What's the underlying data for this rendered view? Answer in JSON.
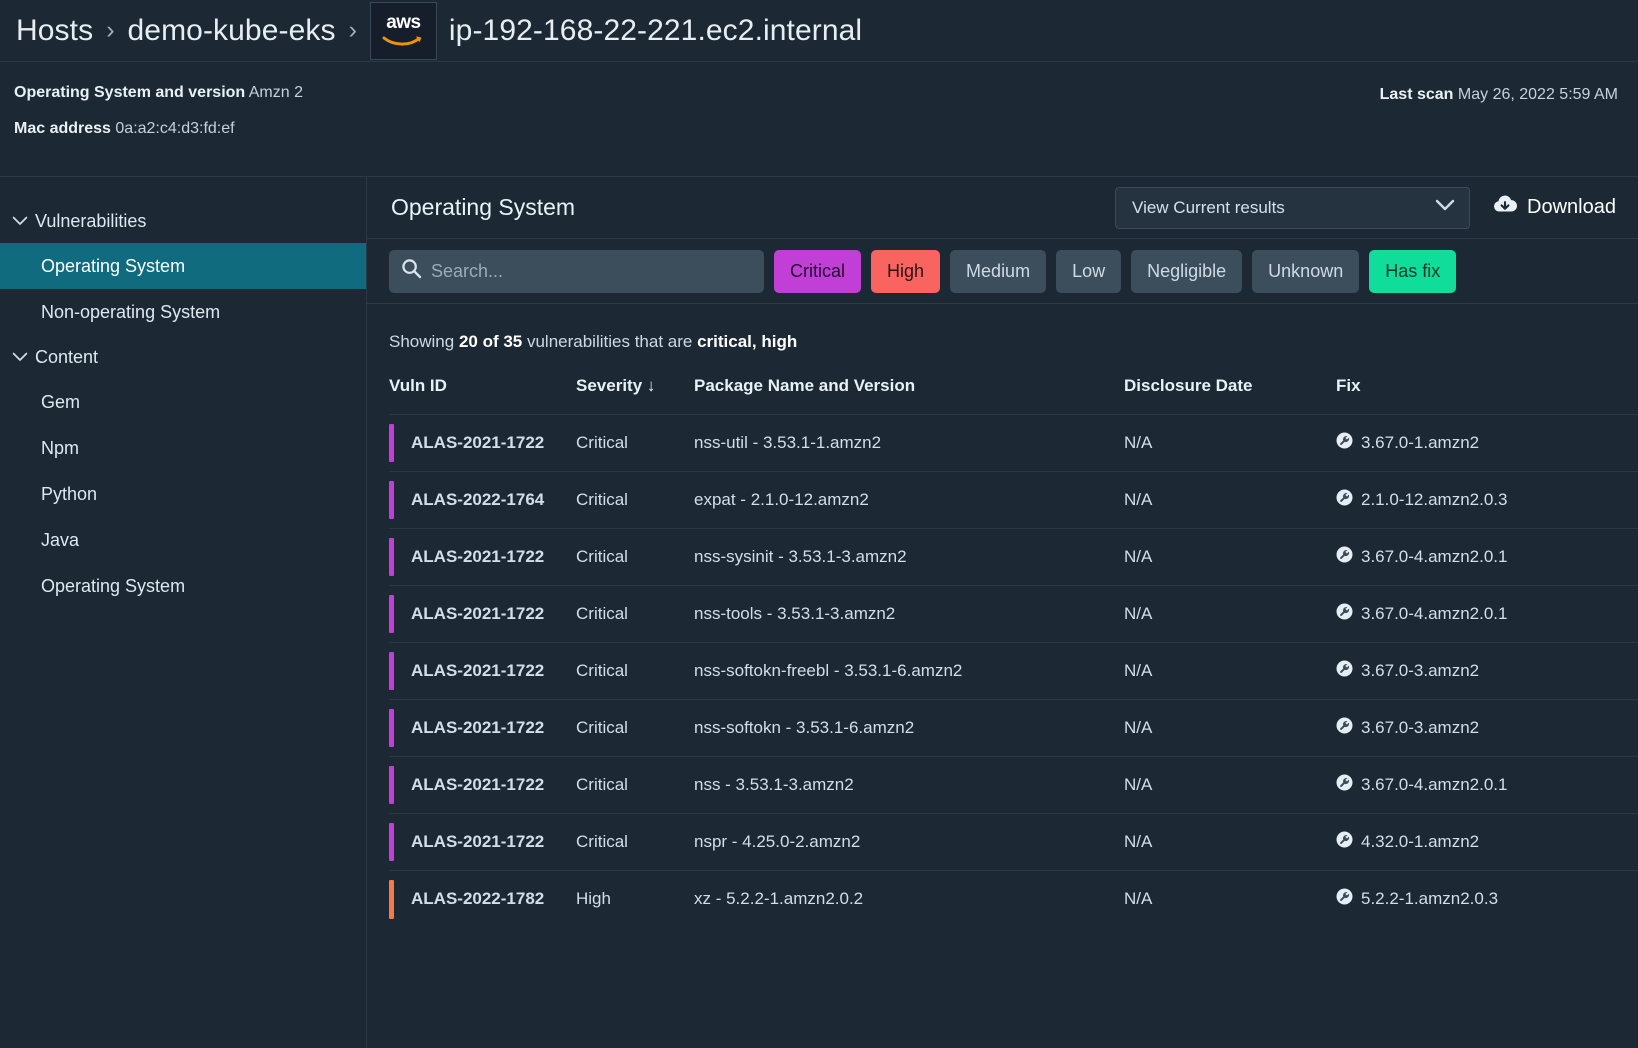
{
  "breadcrumb": {
    "root": "Hosts",
    "separator": "›",
    "cluster": "demo-kube-eks",
    "cloud_icon": "aws-logo-icon",
    "cloud_word": "aws",
    "host": "ip-192-168-22-221.ec2.internal"
  },
  "meta": {
    "os_label": "Operating System and version",
    "os_value": "Amzn 2",
    "mac_label": "Mac address",
    "mac_value": "0a:a2:c4:d3:fd:ef",
    "last_scan_label": "Last scan",
    "last_scan_value": "May 26, 2022 5:59 AM"
  },
  "sidebar": {
    "groups": [
      {
        "label": "Vulnerabilities",
        "icon": "chevron-down-icon",
        "items": [
          {
            "label": "Operating System",
            "active": true
          },
          {
            "label": "Non-operating System",
            "active": false
          }
        ]
      },
      {
        "label": "Content",
        "icon": "chevron-down-icon",
        "items": [
          {
            "label": "Gem",
            "active": false
          },
          {
            "label": "Npm",
            "active": false
          },
          {
            "label": "Python",
            "active": false
          },
          {
            "label": "Java",
            "active": false
          },
          {
            "label": "Operating System",
            "active": false
          }
        ]
      }
    ]
  },
  "panel": {
    "title": "Operating System",
    "view_select": {
      "value": "View Current results",
      "icon": "chevron-down-icon"
    },
    "download": {
      "label": "Download",
      "icon": "cloud-download-icon"
    }
  },
  "filters": {
    "search_placeholder": "Search...",
    "search_value": "",
    "search_icon": "search-icon",
    "chips": [
      {
        "label": "Critical",
        "style": "critical"
      },
      {
        "label": "High",
        "style": "high"
      },
      {
        "label": "Medium",
        "style": "neutral"
      },
      {
        "label": "Low",
        "style": "neutral"
      },
      {
        "label": "Negligible",
        "style": "neutral"
      },
      {
        "label": "Unknown",
        "style": "neutral"
      },
      {
        "label": "Has fix",
        "style": "hasfix"
      }
    ]
  },
  "summary": {
    "prefix": "Showing ",
    "count": "20 of 35",
    "middle": " vulnerabilities that are ",
    "severities": "critical, high"
  },
  "table": {
    "columns": [
      "Vuln ID",
      "Severity ↓",
      "Package Name and Version",
      "Disclosure Date",
      "Fix"
    ],
    "fix_icon": "wrench-fix-icon",
    "rows": [
      {
        "vuln_id": "ALAS-2021-1722",
        "severity": "Critical",
        "package": "nss-util - 3.53.1-1.amzn2",
        "disclosure": "N/A",
        "fix": "3.67.0-1.amzn2",
        "bar": "#c13fd6"
      },
      {
        "vuln_id": "ALAS-2022-1764",
        "severity": "Critical",
        "package": "expat - 2.1.0-12.amzn2",
        "disclosure": "N/A",
        "fix": "2.1.0-12.amzn2.0.3",
        "bar": "#c13fd6"
      },
      {
        "vuln_id": "ALAS-2021-1722",
        "severity": "Critical",
        "package": "nss-sysinit - 3.53.1-3.amzn2",
        "disclosure": "N/A",
        "fix": "3.67.0-4.amzn2.0.1",
        "bar": "#c13fd6"
      },
      {
        "vuln_id": "ALAS-2021-1722",
        "severity": "Critical",
        "package": "nss-tools - 3.53.1-3.amzn2",
        "disclosure": "N/A",
        "fix": "3.67.0-4.amzn2.0.1",
        "bar": "#c13fd6"
      },
      {
        "vuln_id": "ALAS-2021-1722",
        "severity": "Critical",
        "package": "nss-softokn-freebl - 3.53.1-6.amzn2",
        "disclosure": "N/A",
        "fix": "3.67.0-3.amzn2",
        "bar": "#c13fd6"
      },
      {
        "vuln_id": "ALAS-2021-1722",
        "severity": "Critical",
        "package": "nss-softokn - 3.53.1-6.amzn2",
        "disclosure": "N/A",
        "fix": "3.67.0-3.amzn2",
        "bar": "#c13fd6"
      },
      {
        "vuln_id": "ALAS-2021-1722",
        "severity": "Critical",
        "package": "nss - 3.53.1-3.amzn2",
        "disclosure": "N/A",
        "fix": "3.67.0-4.amzn2.0.1",
        "bar": "#c13fd6"
      },
      {
        "vuln_id": "ALAS-2021-1722",
        "severity": "Critical",
        "package": "nspr - 4.25.0-2.amzn2",
        "disclosure": "N/A",
        "fix": "4.32.0-1.amzn2",
        "bar": "#c13fd6"
      },
      {
        "vuln_id": "ALAS-2022-1782",
        "severity": "High",
        "package": "xz - 5.2.2-1.amzn2.0.2",
        "disclosure": "N/A",
        "fix": "5.2.2-1.amzn2.0.3",
        "bar": "#f47b45"
      }
    ]
  },
  "colors": {
    "background": "#1c2833",
    "panel_border": "#2c3a47",
    "active_nav": "#116b7f",
    "critical": "#c13fd6",
    "high": "#fa6460",
    "has_fix": "#10dd99",
    "chip_neutral": "#3c4d5c",
    "aws_orange": "#f0910a"
  }
}
